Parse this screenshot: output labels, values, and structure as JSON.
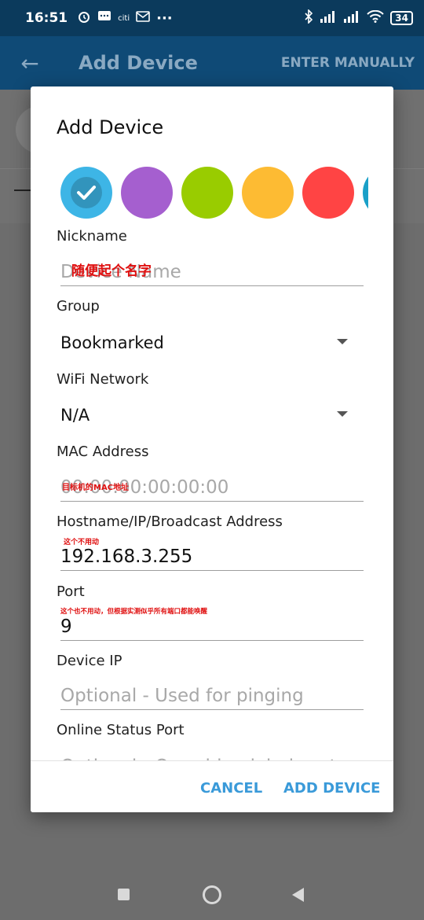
{
  "status_bar": {
    "time": "16:51",
    "left_icons": [
      "alarm-icon",
      "message-icon",
      "citi",
      "outlook-icon",
      "more-icon"
    ],
    "citi_label": "citi",
    "more_label": "···",
    "battery": "34"
  },
  "app_bar": {
    "back_icon": "←",
    "title": "Add Device",
    "enter_manually": "ENTER MANUALLY"
  },
  "dialog": {
    "title": "Add Device",
    "colors": [
      "#3db5e6",
      "#a55fcf",
      "#99cc00",
      "#fdbb33",
      "#ff4444",
      "#1aa0c8"
    ],
    "selected_color_index": 0,
    "nickname_label": "Nickname",
    "nickname_placeholder": "Device Name",
    "nickname_note": "随便起个名字",
    "group_label": "Group",
    "group_value": "Bookmarked",
    "wifi_label": "WiFi Network",
    "wifi_value": "N/A",
    "mac_label": "MAC Address",
    "mac_placeholder": "00:00:00:00:00:00",
    "mac_note": "目标机的MAC地址",
    "host_label": "Hostname/IP/Broadcast Address",
    "host_note": "这个不用动",
    "host_value": "192.168.3.255",
    "port_label": "Port",
    "port_note": "这个也不用动，但根据实测似乎所有端口都能唤醒",
    "port_value": "9",
    "device_ip_label": "Device IP",
    "device_ip_placeholder": "Optional - Used for pinging",
    "online_port_label": "Online Status Port",
    "online_port_placeholder": "Optional - Override global port",
    "cancel": "CANCEL",
    "add": "ADD DEVICE"
  }
}
